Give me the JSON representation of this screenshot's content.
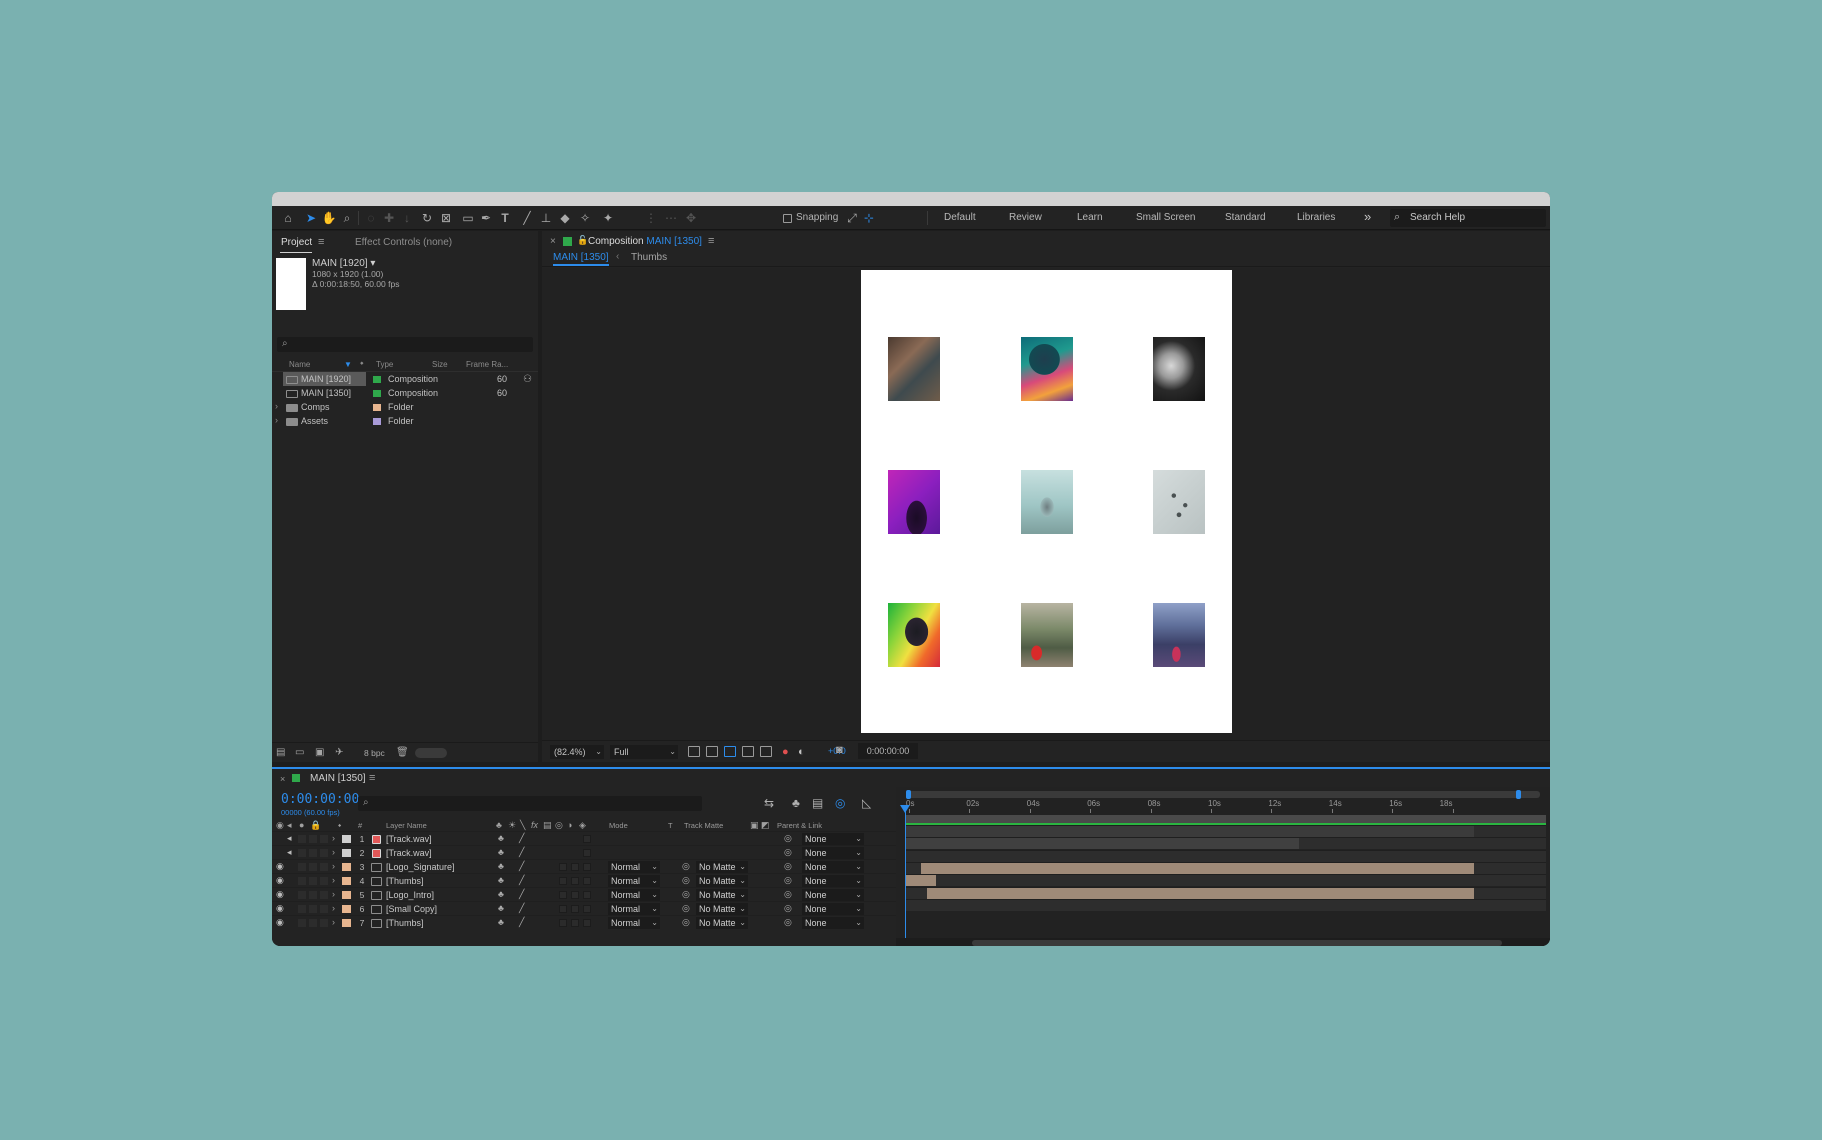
{
  "toolbar": {
    "snapping_label": "Snapping",
    "workspaces": [
      "Default",
      "Review",
      "Learn",
      "Small Screen",
      "Standard",
      "Libraries"
    ],
    "more_icon": "»",
    "search_help_placeholder": "Search Help"
  },
  "project_panel": {
    "tab_project": "Project",
    "tab_effect_controls": "Effect Controls (none)",
    "selected_name": "MAIN [1920] ▾",
    "selected_size": "1080 x 1920 (1.00)",
    "selected_duration": "Δ 0:00:18:50, 60.00 fps",
    "columns": {
      "name": "Name",
      "type": "Type",
      "size": "Size",
      "frame_rate": "Frame Ra..."
    },
    "bpc_label": "8 bpc",
    "items": [
      {
        "name": "MAIN [1920]",
        "type": "Composition",
        "frame_rate": "60",
        "color": "#2fa84b",
        "kind": "comp",
        "selected": true
      },
      {
        "name": "MAIN [1350]",
        "type": "Composition",
        "frame_rate": "60",
        "color": "#2fa84b",
        "kind": "comp",
        "selected": false
      },
      {
        "name": "Comps",
        "type": "Folder",
        "frame_rate": "",
        "color": "#e7b58f",
        "kind": "folder",
        "selected": false
      },
      {
        "name": "Assets",
        "type": "Folder",
        "frame_rate": "",
        "color": "#a99bd8",
        "kind": "folder",
        "selected": false
      }
    ]
  },
  "viewer": {
    "tab_prefix": "Composition",
    "tab_comp": "MAIN [1350]",
    "breadcrumb_active": "MAIN [1350]",
    "breadcrumb_separator": "‹",
    "breadcrumb_next": "Thumbs",
    "zoom": "(82.4%)",
    "resolution": "Full",
    "exposure": "+0.0",
    "timecode": "0:00:00:00"
  },
  "timeline": {
    "comp_name": "MAIN [1350]",
    "timecode": "0:00:00:00",
    "fps": "00000 (60.00 fps)",
    "columns": {
      "layer_name": "Layer Name",
      "mode": "Mode",
      "t": "T",
      "track_matte": "Track Matte",
      "parent": "Parent & Link"
    },
    "ruler": [
      "0s",
      "02s",
      "04s",
      "06s",
      "08s",
      "10s",
      "12s",
      "14s",
      "16s",
      "18s"
    ],
    "layers": [
      {
        "num": "1",
        "name": "[Track.wav]",
        "kind": "audio",
        "label": "#cfcfcf",
        "mode": "",
        "matte": "",
        "parent": "None",
        "bar_start_s": 0,
        "bar_end_s": 18.8,
        "bar_color": "#3b3b3b"
      },
      {
        "num": "2",
        "name": "[Track.wav]",
        "kind": "audio",
        "label": "#cfcfcf",
        "mode": "",
        "matte": "",
        "parent": "None",
        "bar_start_s": 0,
        "bar_end_s": 13,
        "bar_color": "#404040"
      },
      {
        "num": "3",
        "name": "[Logo_Signature]",
        "kind": "comp",
        "label": "#e7b58f",
        "mode": "Normal",
        "matte": "No Matte",
        "parent": "None",
        "bar_start_s": 0,
        "bar_end_s": 0,
        "bar_color": "#9f8a78"
      },
      {
        "num": "4",
        "name": "[Thumbs]",
        "kind": "comp",
        "label": "#e7b58f",
        "mode": "Normal",
        "matte": "No Matte",
        "parent": "None",
        "bar_start_s": 0.5,
        "bar_end_s": 18.8,
        "bar_color": "#9f8a78"
      },
      {
        "num": "5",
        "name": "[Logo_Intro]",
        "kind": "comp",
        "label": "#e7b58f",
        "mode": "Normal",
        "matte": "No Matte",
        "parent": "None",
        "bar_start_s": 0,
        "bar_end_s": 1,
        "bar_color": "#9f8a78"
      },
      {
        "num": "6",
        "name": "[Small Copy]",
        "kind": "comp",
        "label": "#e7b58f",
        "mode": "Normal",
        "matte": "No Matte",
        "parent": "None",
        "bar_start_s": 0.7,
        "bar_end_s": 18.8,
        "bar_color": "#9f8a78"
      },
      {
        "num": "7",
        "name": "[Thumbs]",
        "kind": "comp",
        "label": "#e7b58f",
        "mode": "Normal",
        "matte": "No Matte",
        "parent": "None",
        "bar_start_s": 0,
        "bar_end_s": 0,
        "bar_color": "#9f8a78"
      }
    ]
  },
  "colors": {
    "accent": "#2d8ceb",
    "comp_label": "#2fa84b",
    "work_area": "#2bb541"
  }
}
